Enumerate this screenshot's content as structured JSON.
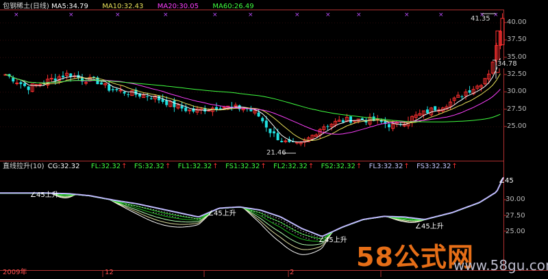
{
  "window": {
    "stock": "包钢稀土(日线)",
    "legend": [
      {
        "label": "MA5:34.79",
        "color": "#ffffff"
      },
      {
        "label": "MA10:32.43",
        "color": "#e8e05a"
      },
      {
        "label": "MA20:30.05",
        "color": "#ff40ff"
      },
      {
        "label": "MA60:26.49",
        "color": "#40ff40"
      }
    ]
  },
  "main_chart": {
    "price_axis": [
      "40.00",
      "37.50",
      "35.00",
      "32.50",
      "30.00",
      "27.50",
      "25.00"
    ],
    "high_label": "41.35",
    "low_label": "21.46",
    "current_label": "34.78"
  },
  "indicator": {
    "name": "直线拉升(10)",
    "params": [
      {
        "label": "CG:32.32",
        "color": "#ffffff",
        "arrow": false
      },
      {
        "label": "FL:32.32",
        "color": "#40ff40",
        "arrow": true
      },
      {
        "label": "FS:32.32",
        "color": "#40ff40",
        "arrow": true
      },
      {
        "label": "FL1:32.32",
        "color": "#40ff40",
        "arrow": true
      },
      {
        "label": "FS1:32.32",
        "color": "#40ff40",
        "arrow": true
      },
      {
        "label": "FL2:32.32",
        "color": "#40ff40",
        "arrow": true
      },
      {
        "label": "FS2:32.32",
        "color": "#40ff40",
        "arrow": true
      },
      {
        "label": "FL3:32.32",
        "color": "#c8c8ff",
        "arrow": true
      },
      {
        "label": "FS3:32.32",
        "color": "#c8c8ff",
        "arrow": true
      }
    ],
    "axis": [
      "30.00",
      "27.50",
      "25.00"
    ],
    "annotations": [
      "∠45上升",
      "∠45上升",
      "∠45上升",
      "∠45上升",
      "∠45"
    ]
  },
  "time_axis": [
    "2009年",
    "12",
    "2"
  ],
  "watermark": {
    "big": "58公式网",
    "url": "www.58gu.com"
  },
  "colors": {
    "up": "#ff3030",
    "down": "#20e0e0",
    "green": "#30ff30"
  }
}
